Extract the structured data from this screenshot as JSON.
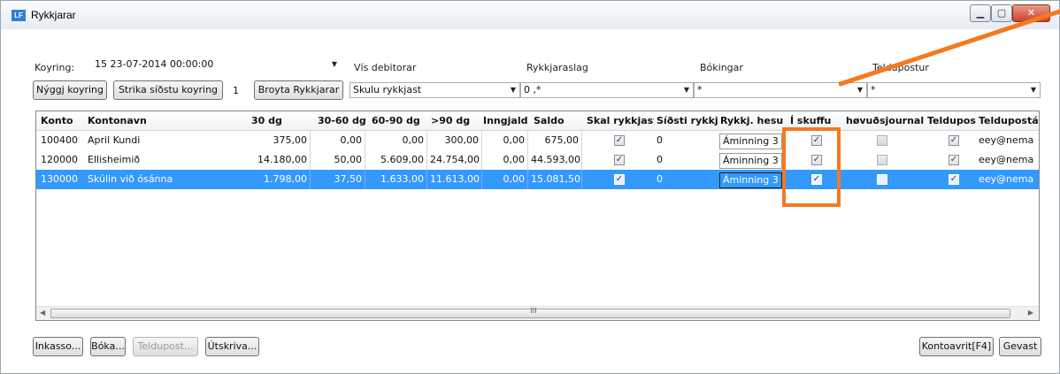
{
  "window": {
    "title": "Rykkjarar",
    "app_icon": "LF",
    "min_icon": "window-minimize-icon",
    "max_icon": "window-maximize-icon",
    "close_icon": "window-close-icon"
  },
  "filters": {
    "koyring_label": "Koyring:",
    "koyring_value": "15    23-07-2014 00:00:00",
    "vis_debitorar_label": "Vís debitorar",
    "vis_debitorar_value": "Skulu rykkjast",
    "rykkjaraslag_label": "Rykkjaraslag",
    "rykkjaraslag_value": "0 ,*",
    "bokingar_label": "Bókingar",
    "bokingar_value": "*",
    "teldupostur_label": "Teldupostur",
    "teldupostur_value": "*"
  },
  "toolbar": {
    "nyggj_koyring": "Nýggj koyring",
    "strika_sidstu": "Strika síðstu koyring",
    "count": "1",
    "broyta_rykkjarar": "Broyta Rykkjarar"
  },
  "grid": {
    "columns": [
      "Konto",
      "Kontonavn",
      "30 dg",
      "30-60 dg",
      "60-90 dg",
      ">90 dg",
      "Inngjald",
      "Saldo",
      "Skal rykkjast",
      "Síðsti rykkj.",
      "Rykkj. hesu",
      "Í skuffu",
      "høvuðsjournal",
      "Teldupost",
      "Teldupostá"
    ],
    "rows": [
      {
        "konto": "100400",
        "navn": "April Kundi",
        "d30": "375,00",
        "d30_60": "0,00",
        "d60_90": "0,00",
        "d90": "300,00",
        "inngjald": "0,00",
        "saldo": "675,00",
        "skal": true,
        "sidsti": "0",
        "hesu": "Áminning 3",
        "skuffu": true,
        "journal": false,
        "teldupost": true,
        "email": "eey@nema"
      },
      {
        "konto": "120000",
        "navn": "Ellisheimið",
        "d30": "14.180,00",
        "d30_60": "50,00",
        "d60_90": "5.609,00",
        "d90": "24.754,00",
        "inngjald": "0,00",
        "saldo": "44.593,00",
        "skal": true,
        "sidsti": "0",
        "hesu": "Áminning 3",
        "skuffu": true,
        "journal": false,
        "teldupost": true,
        "email": "eey@nema"
      },
      {
        "konto": "130000",
        "navn": "Skúlin við ósánna",
        "d30": "1.798,00",
        "d30_60": "37,50",
        "d60_90": "1.633,00",
        "d90": "11.613,00",
        "inngjald": "0,00",
        "saldo": "15.081,50",
        "skal": true,
        "sidsti": "0",
        "hesu": "Áminning 3",
        "skuffu": true,
        "journal": false,
        "teldupost": true,
        "email": "eey@nema",
        "selected": true
      }
    ],
    "scroll_grip": "III"
  },
  "footer": {
    "inkasso": "Inkasso...",
    "boka": "Bóka...",
    "teldupost": "Teldupost...",
    "utskriva": "Útskriva...",
    "kontoavrit": "Kontoavrit[F4]",
    "gevast": "Gevast"
  },
  "colors": {
    "highlight": "#f47920",
    "selection": "#3399ff"
  }
}
